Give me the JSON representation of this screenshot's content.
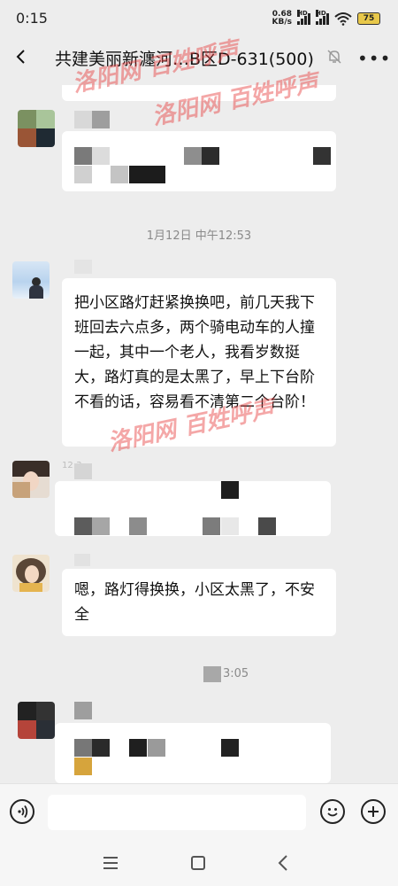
{
  "status_bar": {
    "time": "0:15",
    "net_speed": "0.68",
    "net_unit": "KB/s",
    "sig1_label": "HD",
    "sig2_label": "HD",
    "battery": "75"
  },
  "header": {
    "title": "共建美丽新瀍河…B区D-631(500)"
  },
  "timestamps": {
    "t1": "1月12日 中午12:53",
    "t2_partial": "3:05"
  },
  "messages": {
    "m2_text": "把小区路灯赶紧换换吧，前几天我下班回去六点多，两个骑电动车的人撞一起，其中一个老人，我看岁数挺大，路灯真的是太黑了，早上下台阶不看的话，容易看不清第二个台阶！",
    "m4_text": "嗯，路灯得换换，小区太黑了，不安全",
    "m3_partial_time": "12:3"
  },
  "watermark": {
    "site": "洛阳网",
    "column": "百姓呼声"
  },
  "colors": {
    "background": "#ededed",
    "bubble": "#ffffff",
    "watermark": "#e63c3c"
  },
  "icons": {
    "back": "chevron-left-icon",
    "mute": "bell-off-icon",
    "more": "more-icon",
    "voice": "voice-icon",
    "emoji": "emoji-icon",
    "plus": "plus-icon"
  }
}
